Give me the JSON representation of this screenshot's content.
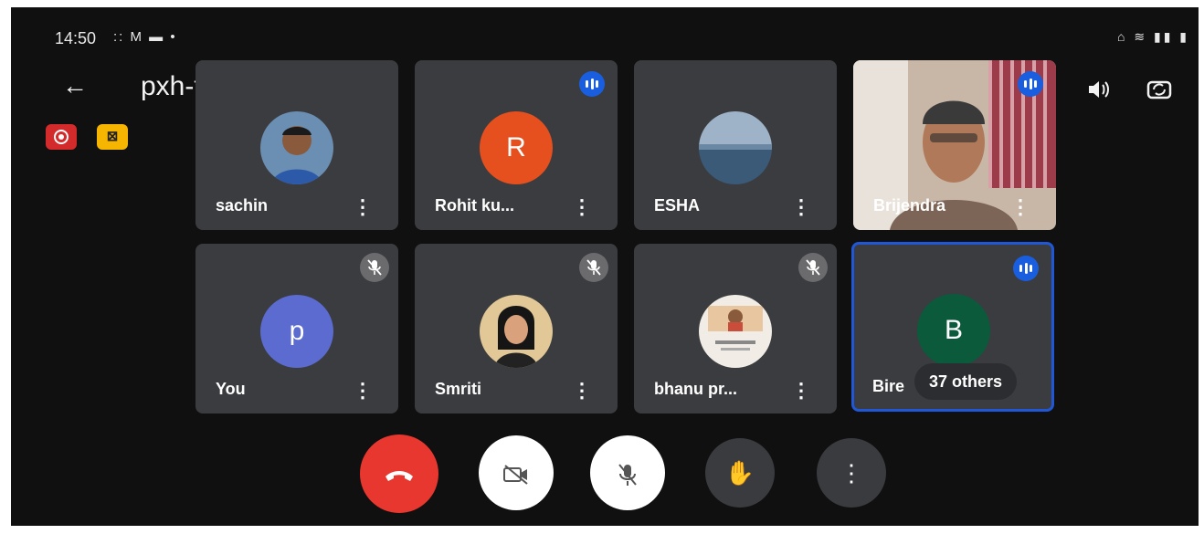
{
  "status_bar": {
    "time": "14:50",
    "left_icons": ":: M ▬ •",
    "right_icons": "⌂ ≋ ▮▮ ▮"
  },
  "header": {
    "meeting_code": "pxh-tgof-uva",
    "back_icon": "arrow-left-icon",
    "title_arrow": "▸",
    "speaker_icon": "🔈",
    "switch_camera_icon": "⟳"
  },
  "badges": {
    "recording": "recording-icon",
    "captions": "⊠"
  },
  "tiles": [
    {
      "name": "sachin",
      "type": "photo",
      "speaking": false,
      "muted": false
    },
    {
      "name": "Rohit ku...",
      "type": "initial",
      "initial": "R",
      "color": "#e5501e",
      "speaking": true,
      "muted": false
    },
    {
      "name": "ESHA",
      "type": "photo",
      "speaking": false,
      "muted": false
    },
    {
      "name": "Brijendra",
      "type": "video",
      "speaking": true,
      "muted": false
    },
    {
      "name": "You",
      "type": "initial",
      "initial": "p",
      "color": "#5b6bd0",
      "speaking": false,
      "muted": true
    },
    {
      "name": "Smriti",
      "type": "photo",
      "speaking": false,
      "muted": true
    },
    {
      "name": "bhanu pr...",
      "type": "photo",
      "speaking": false,
      "muted": true
    },
    {
      "name": "Bire",
      "type": "initial",
      "initial": "B",
      "color": "#0b5a3c",
      "speaking": true,
      "muted": false,
      "others": "37 others"
    }
  ],
  "controls": {
    "end_call": "end-call",
    "camera": "camera-off",
    "mic": "mic-off",
    "raise_hand": "✋",
    "more": "⋮"
  },
  "colors": {
    "screen_bg": "#101011",
    "tile_bg": "#3b3c3f",
    "speaking_blue": "#1a5ee0",
    "end_call_red": "#e8372e",
    "active_border": "#1f57d6"
  }
}
